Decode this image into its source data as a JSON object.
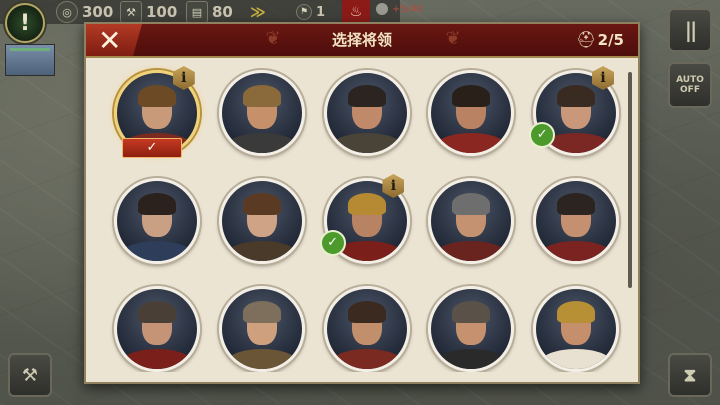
{
  "hud": {
    "alert_glyph": "!",
    "resources": [
      {
        "icon": "coin-icon",
        "glyph": "◎",
        "value": "300"
      },
      {
        "icon": "hammer-icon",
        "glyph": "⚒",
        "value": "100"
      },
      {
        "icon": "scroll-icon",
        "glyph": "▤",
        "value": "80"
      }
    ],
    "rank_glyph": "≫",
    "unit_count": "1",
    "flame_glyph": "♨",
    "pop_value": "+5/40",
    "pause_glyph": "||",
    "auto_label": "AUTO",
    "auto_sub": "OFF"
  },
  "dialog": {
    "close_glyph": "✕",
    "title": "选择将领",
    "laurel_glyph": "❦",
    "helmet_glyph": "⛑",
    "selected_count": "2/5"
  },
  "generals": [
    {
      "selected_tab": true,
      "info": true,
      "check": false,
      "skin": "#c89a7a",
      "hair": "#6b4a25",
      "cloth": "#7b2a20"
    },
    {
      "selected_tab": false,
      "info": false,
      "check": false,
      "skin": "#c6916a",
      "hair": "#8a6a3a",
      "cloth": "#3a3a3a"
    },
    {
      "selected_tab": false,
      "info": false,
      "check": false,
      "skin": "#c08a6a",
      "hair": "#2b2420",
      "cloth": "#4a4338"
    },
    {
      "selected_tab": false,
      "info": false,
      "check": false,
      "skin": "#b98262",
      "hair": "#2a201a",
      "cloth": "#8a2720"
    },
    {
      "selected_tab": false,
      "info": true,
      "check": true,
      "skin": "#c9987a",
      "hair": "#3a2b22",
      "cloth": "#7b2723"
    },
    {
      "selected_tab": false,
      "info": false,
      "check": false,
      "skin": "#caa085",
      "hair": "#2b221e",
      "cloth": "#2e3d5a"
    },
    {
      "selected_tab": false,
      "info": false,
      "check": false,
      "skin": "#cfa385",
      "hair": "#5a3a22",
      "cloth": "#4a3a2a"
    },
    {
      "selected_tab": false,
      "info": true,
      "check": true,
      "skin": "#b88363",
      "hair": "#b58a32",
      "cloth": "#7a1f1a"
    },
    {
      "selected_tab": false,
      "info": false,
      "check": false,
      "skin": "#c49270",
      "hair": "#6e6e6e",
      "cloth": "#6a2420"
    },
    {
      "selected_tab": false,
      "info": false,
      "check": false,
      "skin": "#c49070",
      "hair": "#2c2420",
      "cloth": "#7a2320"
    },
    {
      "selected_tab": false,
      "info": false,
      "check": false,
      "skin": "#c59476",
      "hair": "#4a3f36",
      "cloth": "#7a1f1a"
    },
    {
      "selected_tab": false,
      "info": false,
      "check": false,
      "skin": "#cfa07e",
      "hair": "#7e6f5c",
      "cloth": "#6a5536"
    },
    {
      "selected_tab": false,
      "info": false,
      "check": false,
      "skin": "#c28f6c",
      "hair": "#3a2a20",
      "cloth": "#7a2a20"
    },
    {
      "selected_tab": false,
      "info": false,
      "check": false,
      "skin": "#c6916e",
      "hair": "#5a5248",
      "cloth": "#2a2a2a"
    },
    {
      "selected_tab": false,
      "info": false,
      "check": false,
      "skin": "#c68f6c",
      "hair": "#b78f35",
      "cloth": "#e8e0d0"
    }
  ],
  "badges": {
    "info_glyph": "i",
    "check_glyph": "✓"
  },
  "colors": {
    "header_red": "#6a1713",
    "panel": "#ece4d3",
    "accent_gold": "#c9a55b",
    "check_green": "#4c9a2c"
  }
}
